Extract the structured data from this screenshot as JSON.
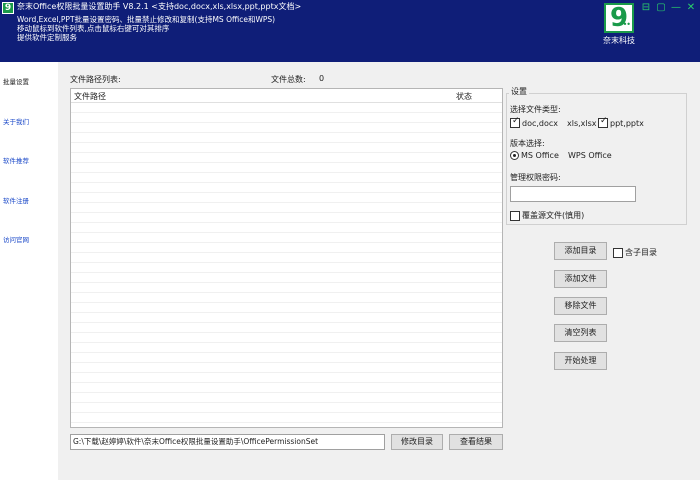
{
  "header": {
    "title": "奈末Office权限批量设置助手  V8.2.1   <支持doc,docx,xls,xlsx,ppt,pptx文档>",
    "desc_lines": [
      "Word,Excel,PPT批量设置密码、批量禁止修改和复制(支持MS Office和WPS)",
      "移动鼠标到软件列表,点击鼠标右键可对其排序",
      "提供软件定制服务"
    ],
    "brand_name": "奈末科技",
    "brand_digit": "9",
    "brand_dots": "•••",
    "win_controls": [
      "⊟",
      "▢",
      "—",
      "✕"
    ]
  },
  "sidebar": {
    "items": [
      {
        "label": "批量设置"
      },
      {
        "label": "关于我们"
      },
      {
        "label": "软件推荐"
      },
      {
        "label": "软件注册"
      },
      {
        "label": "访问官网"
      }
    ]
  },
  "file_list": {
    "label": "文件路径列表:",
    "count_label": "文件总数:",
    "count": "0",
    "col_path": "文件路径",
    "col_status": "状态"
  },
  "output": {
    "path": "G:\\下载\\赵婷婷\\软件\\奈末Office权限批量设置助手\\OfficePermissionSet",
    "modify_dir": "修改目录",
    "view_result": "查看结果"
  },
  "settings": {
    "title": "设置",
    "file_types_label": "选择文件类型:",
    "file_types": [
      {
        "label": "doc,docx",
        "checked": true
      },
      {
        "label": "xls,xlsx",
        "checked": false
      },
      {
        "label": "ppt,pptx",
        "checked": true
      }
    ],
    "version_label": "版本选择:",
    "versions": [
      {
        "label": "MS Office",
        "checked": true
      },
      {
        "label": "WPS Office",
        "checked": false
      }
    ],
    "password_label": "管理权限密码:",
    "password_value": "",
    "overwrite_label": "覆盖源文件(慎用)"
  },
  "actions": {
    "add_dir": "添加目录",
    "include_subdir": "含子目录",
    "add_file": "添加文件",
    "remove_file": "移除文件",
    "clear_list": "清空列表",
    "start": "开始处理"
  }
}
